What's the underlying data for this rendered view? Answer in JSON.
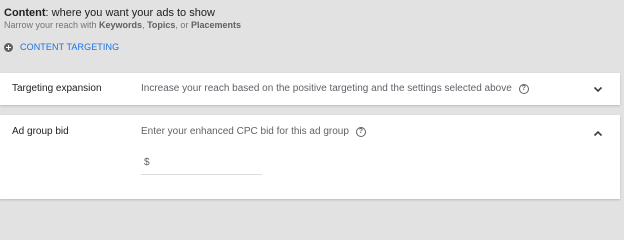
{
  "content": {
    "title_bold": "Content",
    "title_rest": ": where you want your ads to show",
    "subtitle_prefix": "Narrow your reach with ",
    "keywords": "Keywords",
    "comma1": ", ",
    "topics": "Topics",
    "or": ", or ",
    "placements": "Placements",
    "targeting_link": "CONTENT TARGETING",
    "targeting_icon": "add-circle-icon"
  },
  "targeting_expansion": {
    "label": "Targeting expansion",
    "description": "Increase your reach based on the positive targeting and the settings selected above",
    "help_icon": "help-icon",
    "chevron_icon": "chevron-down-icon",
    "expanded": false
  },
  "ad_group_bid": {
    "label": "Ad group bid",
    "description": "Enter your enhanced CPC bid for this ad group",
    "help_icon": "help-icon",
    "chevron_icon": "chevron-up-icon",
    "expanded": true,
    "currency_symbol": "$",
    "bid_value": ""
  },
  "colors": {
    "link": "#1a73e8",
    "background": "#e2e2e2",
    "panel": "#ffffff"
  }
}
